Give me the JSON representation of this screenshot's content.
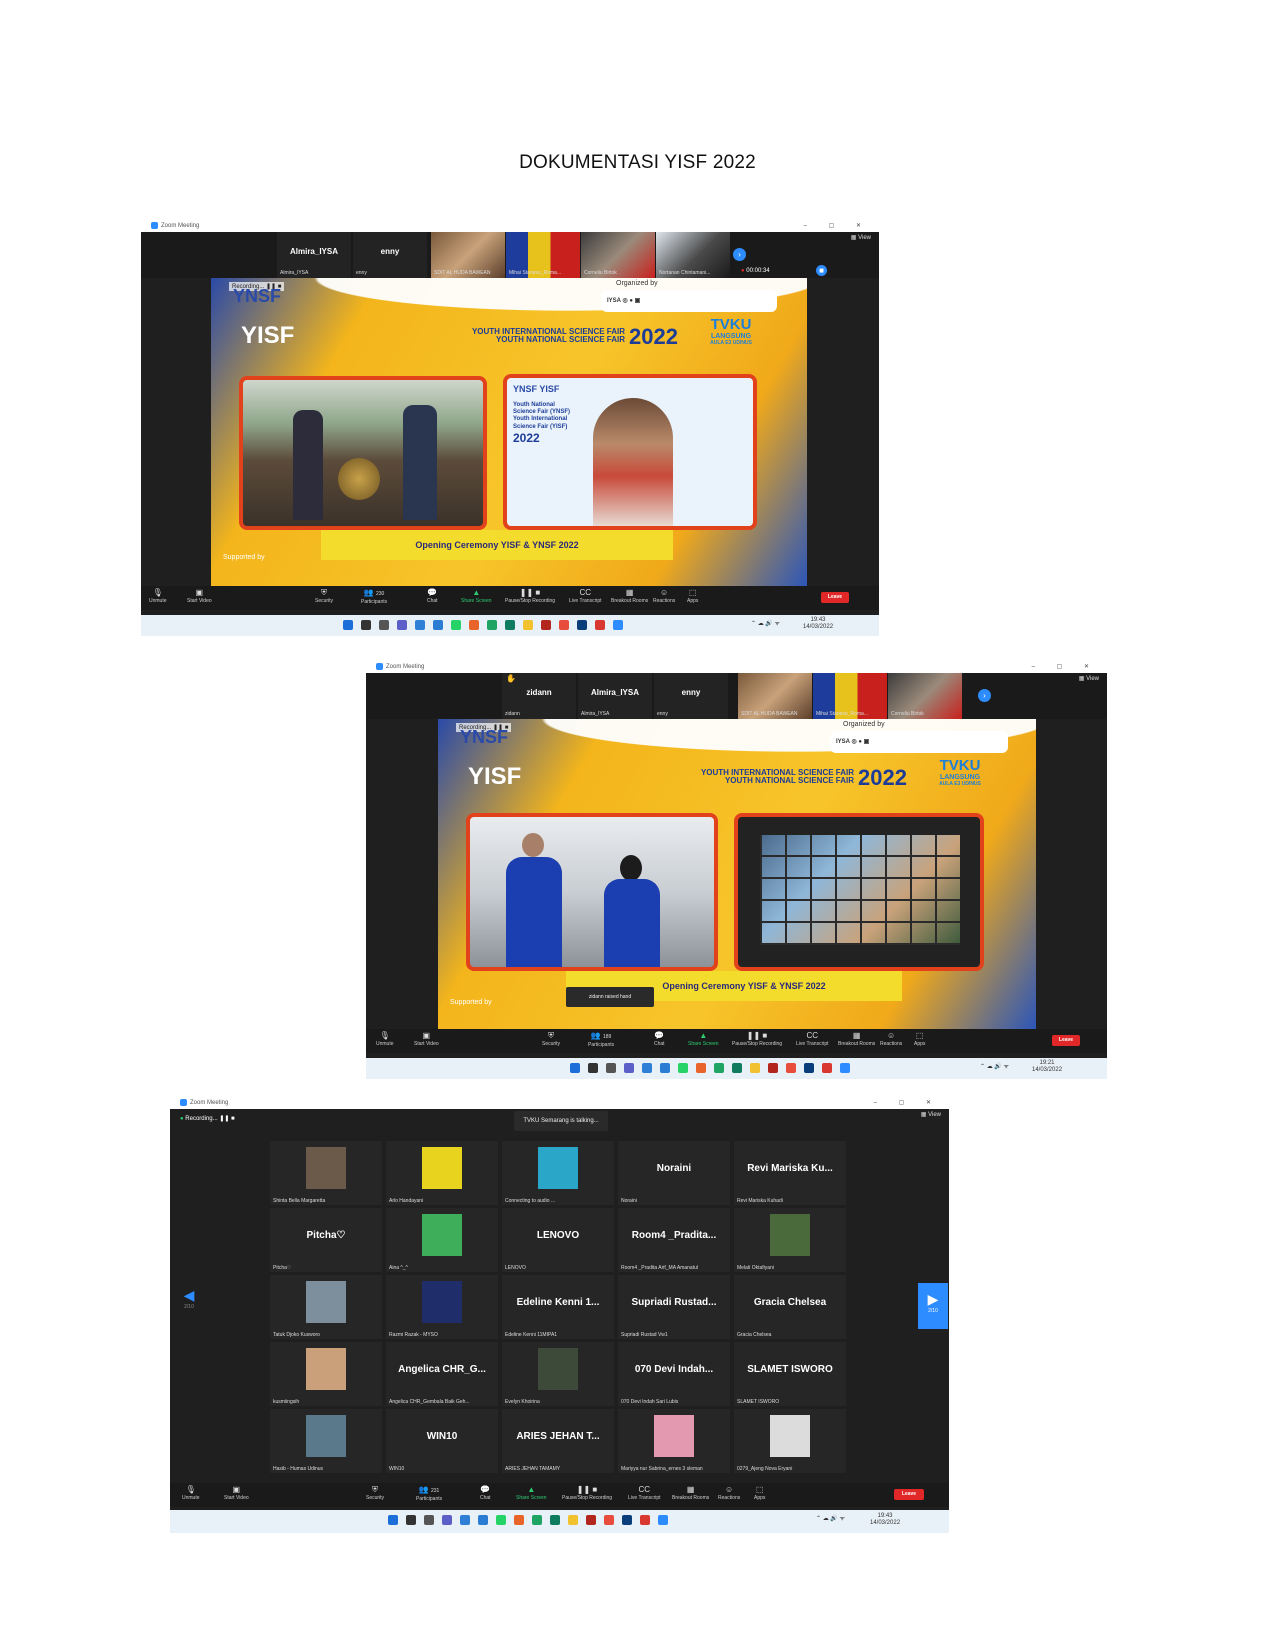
{
  "document": {
    "title": "DOKUMENTASI YISF 2022"
  },
  "zoom": {
    "app_title": "Zoom Meeting",
    "view_label": "View",
    "leave_label": "Leave",
    "recording_label": "Recording...",
    "toolbar": [
      "Unmute",
      "Start Video",
      "Security",
      "Participants",
      "Chat",
      "Share Screen",
      "Pause/Stop Recording",
      "Live Transcript",
      "Breakout Rooms",
      "Reactions",
      "Apps"
    ],
    "accent": "#2d8cff",
    "leave_color": "#e02828"
  },
  "stage": {
    "ynsf_logo": "YNSF",
    "yisf_logo": "YISF",
    "organized_by": "Organized by",
    "line1": "YOUTH INTERNATIONAL SCIENCE FAIR",
    "line2": "YOUTH NATIONAL SCIENCE FAIR",
    "year": "2022",
    "tvku": "TVKU",
    "langsung": "LANGSUNG",
    "aula": "AULA E3 UDINUS",
    "lower_third": "Opening Ceremony YISF & YNSF 2022",
    "supported_by": "Supported by",
    "slide_text": [
      "Youth National",
      "Science Fair (YNSF)",
      "Youth International",
      "Science Fair (YISF)"
    ],
    "slide_year": "2022",
    "brand_yellow": "#f7c52a",
    "brand_blue": "#1c3c98",
    "frame_red": "#e2421b"
  },
  "shot1": {
    "tiles": [
      {
        "name": "Almira_IYSA",
        "sub": "Almira_IYSA"
      },
      {
        "name": "enny",
        "sub": "enny"
      }
    ],
    "image_tiles": [
      "SDIT AL HUDA BAWEAN",
      "Mihai Stanesu_Roma...",
      "Corneliu Birtok",
      "Nortanan Chintamani..."
    ],
    "timer": "00:00:34",
    "participants": "230",
    "clock": "19:43",
    "date": "14/03/2022"
  },
  "shot2": {
    "tiles": [
      {
        "name": "zidann",
        "sub": "zidann"
      },
      {
        "name": "Almira_IYSA",
        "sub": "Almira_IYSA"
      },
      {
        "name": "enny",
        "sub": "enny"
      }
    ],
    "image_tiles": [
      "SDIT AL HUDA BAWEAN",
      "Mihai Stanesu_Roma...",
      "Corneliu Birtok"
    ],
    "raised_hand": "zidann raised hand",
    "participants": "189",
    "clock": "19:21",
    "date": "14/03/2022"
  },
  "shot3": {
    "talking": "TVKU Semarang is talking...",
    "page_left": "2/10",
    "page_right": "2/10",
    "participants": "231",
    "clock": "19:43",
    "date": "14/03/2022",
    "grid": [
      {
        "name": "",
        "sub": "Shinta Bella Margaretta",
        "avatar": "#6b5a4a"
      },
      {
        "name": "",
        "sub": "Arlo Handayani",
        "avatar": "#e8d31f"
      },
      {
        "name": "",
        "sub": "Connecting to audio ...",
        "avatar": "#2aa6c9"
      },
      {
        "name": "Noraini",
        "sub": "Noraini",
        "avatar": ""
      },
      {
        "name": "Revi Mariska Ku...",
        "sub": "Revi Mariska Kuhadi",
        "avatar": ""
      },
      {
        "name": "Pitcha♡",
        "sub": "Pitcha♡",
        "avatar": ""
      },
      {
        "name": "",
        "sub": "Aina ^_^",
        "avatar": "#3fae5a"
      },
      {
        "name": "LENOVO",
        "sub": "LENOVO",
        "avatar": ""
      },
      {
        "name": "Room4 _Pradita...",
        "sub": "Room4 _Pradita Arif_MA Amanatul",
        "avatar": ""
      },
      {
        "name": "",
        "sub": "Melati Oktafiyani",
        "avatar": "#4b6a3c"
      },
      {
        "name": "",
        "sub": "Tatuk Djoko Kusworo",
        "avatar": "#7d8f9c"
      },
      {
        "name": "",
        "sub": "Razmi Razak - MYSO",
        "avatar": "#1f2d6b"
      },
      {
        "name": "Edeline Kenni 1...",
        "sub": "Edeline Kenni 11MIPA1",
        "avatar": ""
      },
      {
        "name": "Supriadi Rustad...",
        "sub": "Supriadi Rustad Vw1",
        "avatar": ""
      },
      {
        "name": "Gracia Chelsea",
        "sub": "Gracia Chelsea",
        "avatar": ""
      },
      {
        "name": "",
        "sub": "kusmiingsih",
        "avatar": "#c9a07a"
      },
      {
        "name": "Angelica CHR_G...",
        "sub": "Angelica CHR_Gembala Baik Geh...",
        "avatar": ""
      },
      {
        "name": "",
        "sub": "Evelyn Khoirina",
        "avatar": "#3d4a3a"
      },
      {
        "name": "070 Devi Indah...",
        "sub": "070 Devi Indah Sari Lubis",
        "avatar": ""
      },
      {
        "name": "SLAMET ISWORO",
        "sub": "SLAMET ISWORO",
        "avatar": ""
      },
      {
        "name": "",
        "sub": "Hasib - Humas Udinus",
        "avatar": "#5a7a8c"
      },
      {
        "name": "WIN10",
        "sub": "WIN10",
        "avatar": ""
      },
      {
        "name": "ARIES JEHAN T...",
        "sub": "ARIES JEHAN TAMAMY",
        "avatar": ""
      },
      {
        "name": "",
        "sub": "Mariyya nur Sabrina_ernes 3 sleman",
        "avatar": "#e39ab0"
      },
      {
        "name": "",
        "sub": "0279_Ajeng Nova Eryani",
        "avatar": "#dcdcdc"
      }
    ]
  }
}
